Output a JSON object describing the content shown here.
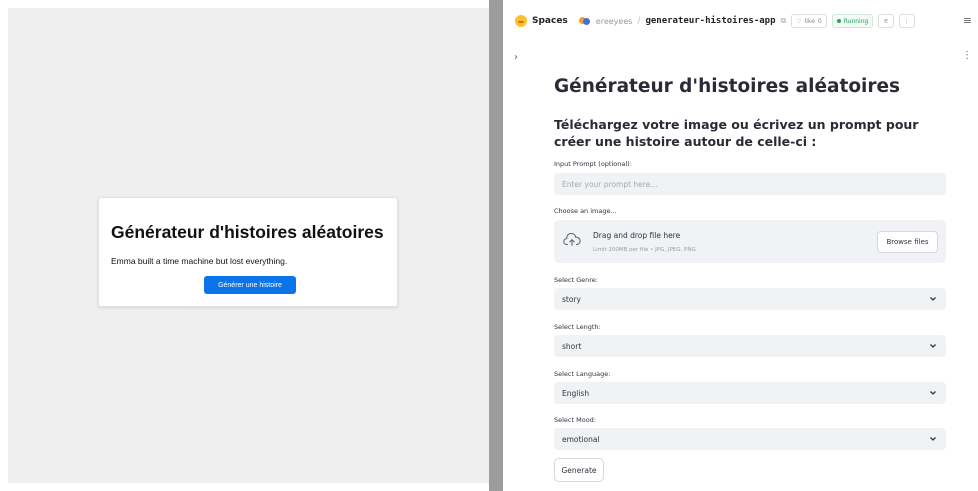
{
  "left_card": {
    "title": "Générateur d'histoires aléatoires",
    "story": "Emma built a time machine but lost everything.",
    "button_label": "Générer une histoire"
  },
  "hf_header": {
    "spaces_label": "Spaces",
    "owner": "ereeyees",
    "slash": "/",
    "repo": "generateur-histoires-app",
    "like_label": "like",
    "like_count": "0",
    "status": "Running",
    "menu_icon": "hamburger-icon"
  },
  "app": {
    "title": "Générateur d'histoires aléatoires",
    "subtitle": "Téléchargez votre image ou écrivez un prompt pour créer une histoire autour de celle-ci :",
    "prompt": {
      "label": "Input Prompt (optional):",
      "placeholder": "Enter your prompt here..."
    },
    "image": {
      "label": "Choose an image...",
      "drop_text": "Drag and drop file here",
      "limit_text": "Limit 200MB per file • JPG, JPEG, PNG",
      "browse_label": "Browse files"
    },
    "genre": {
      "label": "Select Genre:",
      "value": "story"
    },
    "length": {
      "label": "Select Length:",
      "value": "short"
    },
    "language": {
      "label": "Select Language:",
      "value": "English"
    },
    "mood": {
      "label": "Select Mood:",
      "value": "emotional"
    },
    "generate_label": "Generate"
  },
  "colors": {
    "accent_blue": "#0a74e8",
    "field_bg": "#f0f2f6",
    "running_green": "#1f9d55",
    "divider": "#9c9c9c"
  }
}
